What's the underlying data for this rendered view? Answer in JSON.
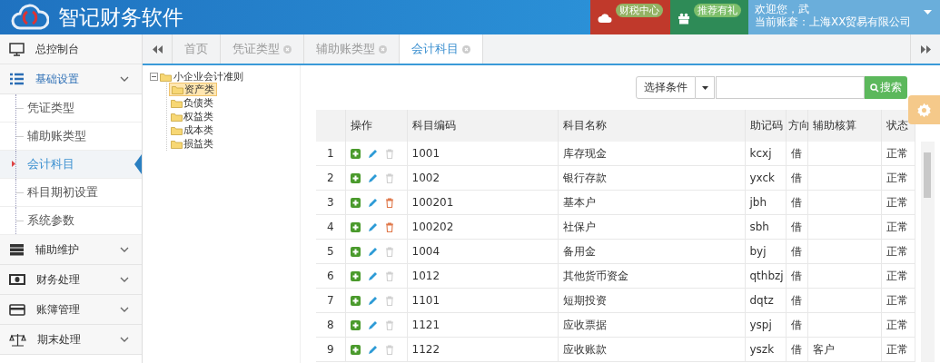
{
  "header": {
    "title": "智记财务软件",
    "badges": [
      {
        "label": "财税中心",
        "color": "#c0392b"
      },
      {
        "label": "推荐有礼",
        "color": "#2e8b57"
      }
    ],
    "user": {
      "greeting": "欢迎您，武",
      "account": "当前账套：上海XX贸易有限公司"
    }
  },
  "sidebar": {
    "items": [
      {
        "label": "总控制台",
        "kind": "link"
      },
      {
        "label": "基础设置",
        "kind": "group",
        "expanded": true,
        "children": [
          {
            "label": "凭证类型",
            "selected": false
          },
          {
            "label": "辅助账类型",
            "selected": false
          },
          {
            "label": "会计科目",
            "selected": true
          },
          {
            "label": "科目期初设置",
            "selected": false
          },
          {
            "label": "系统参数",
            "selected": false
          }
        ]
      },
      {
        "label": "辅助维护",
        "kind": "group",
        "expanded": false
      },
      {
        "label": "财务处理",
        "kind": "group",
        "expanded": false
      },
      {
        "label": "账簿管理",
        "kind": "group",
        "expanded": false
      },
      {
        "label": "期末处理",
        "kind": "group",
        "expanded": false
      }
    ]
  },
  "tabs": [
    {
      "label": "首页",
      "closable": false,
      "selected": false
    },
    {
      "label": "凭证类型",
      "closable": true,
      "selected": false
    },
    {
      "label": "辅助账类型",
      "closable": true,
      "selected": false
    },
    {
      "label": "会计科目",
      "closable": true,
      "selected": true
    }
  ],
  "tree": {
    "label": "小企业会计准则",
    "expanded": true,
    "children": [
      {
        "label": "资产类",
        "selected": true
      },
      {
        "label": "负债类",
        "selected": false
      },
      {
        "label": "权益类",
        "selected": false
      },
      {
        "label": "成本类",
        "selected": false
      },
      {
        "label": "损益类",
        "selected": false
      }
    ]
  },
  "search": {
    "condition": "选择条件",
    "button": "搜索"
  },
  "table": {
    "columns": [
      "操作",
      "科目编码",
      "科目名称",
      "助记码",
      "方向",
      "辅助核算",
      "状态"
    ],
    "rows": [
      {
        "index": "1",
        "code": "1001",
        "name": "库存现金",
        "mnemonic": "kcxj",
        "direction": "借",
        "auxiliary": "",
        "status": "正常",
        "deletable": false
      },
      {
        "index": "2",
        "code": "1002",
        "name": "银行存款",
        "mnemonic": "yxck",
        "direction": "借",
        "auxiliary": "",
        "status": "正常",
        "deletable": false
      },
      {
        "index": "3",
        "code": "100201",
        "name": "基本户",
        "mnemonic": "jbh",
        "direction": "借",
        "auxiliary": "",
        "status": "正常",
        "deletable": true
      },
      {
        "index": "4",
        "code": "100202",
        "name": "社保户",
        "mnemonic": "sbh",
        "direction": "借",
        "auxiliary": "",
        "status": "正常",
        "deletable": true
      },
      {
        "index": "5",
        "code": "1004",
        "name": "备用金",
        "mnemonic": "byj",
        "direction": "借",
        "auxiliary": "",
        "status": "正常",
        "deletable": false
      },
      {
        "index": "6",
        "code": "1012",
        "name": "其他货币资金",
        "mnemonic": "qthbzj",
        "direction": "借",
        "auxiliary": "",
        "status": "正常",
        "deletable": false
      },
      {
        "index": "7",
        "code": "1101",
        "name": "短期投资",
        "mnemonic": "dqtz",
        "direction": "借",
        "auxiliary": "",
        "status": "正常",
        "deletable": false
      },
      {
        "index": "8",
        "code": "1121",
        "name": "应收票据",
        "mnemonic": "yspj",
        "direction": "借",
        "auxiliary": "",
        "status": "正常",
        "deletable": false
      },
      {
        "index": "9",
        "code": "1122",
        "name": "应收账款",
        "mnemonic": "yszk",
        "direction": "借",
        "auxiliary": "客户",
        "status": "正常",
        "deletable": false
      }
    ]
  }
}
